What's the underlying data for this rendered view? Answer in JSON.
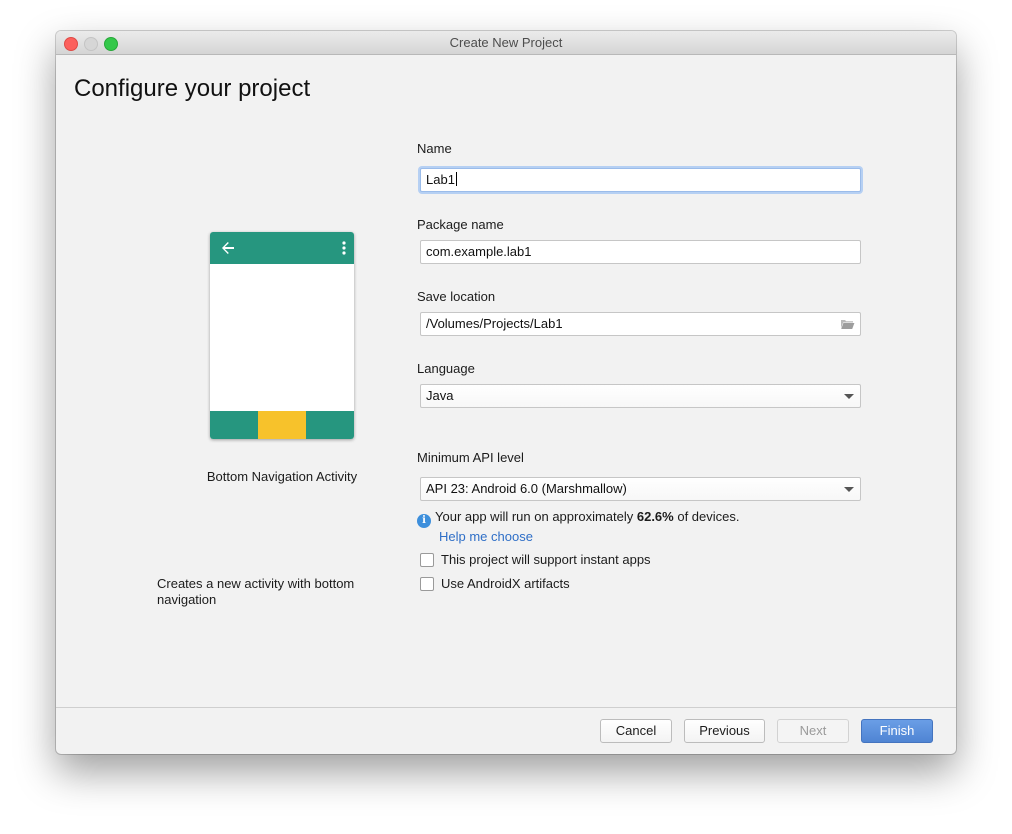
{
  "window": {
    "title": "Create New Project"
  },
  "page": {
    "title": "Configure your project"
  },
  "template": {
    "name": "Bottom Navigation Activity",
    "description": "Creates a new activity with bottom navigation"
  },
  "form": {
    "name": {
      "label": "Name",
      "value": "Lab1"
    },
    "package": {
      "label": "Package name",
      "value": "com.example.lab1"
    },
    "location": {
      "label": "Save location",
      "value": "/Volumes/Projects/Lab1"
    },
    "language": {
      "label": "Language",
      "value": "Java"
    },
    "min_api": {
      "label": "Minimum API level",
      "value": "API 23: Android 6.0 (Marshmallow)"
    },
    "info_prefix": "Your app will run on approximately ",
    "info_percent": "62.6%",
    "info_suffix": " of devices.",
    "help_link": "Help me choose",
    "instant_apps": {
      "label": "This project will support instant apps",
      "checked": false
    },
    "androidx": {
      "label": "Use AndroidX artifacts",
      "checked": false
    }
  },
  "buttons": {
    "cancel": "Cancel",
    "previous": "Previous",
    "next": "Next",
    "finish": "Finish"
  },
  "colors": {
    "preview_primary": "#26967f",
    "preview_accent": "#f7c22b",
    "primary_button": "#5a8fdc",
    "link": "#2f6fc7"
  }
}
